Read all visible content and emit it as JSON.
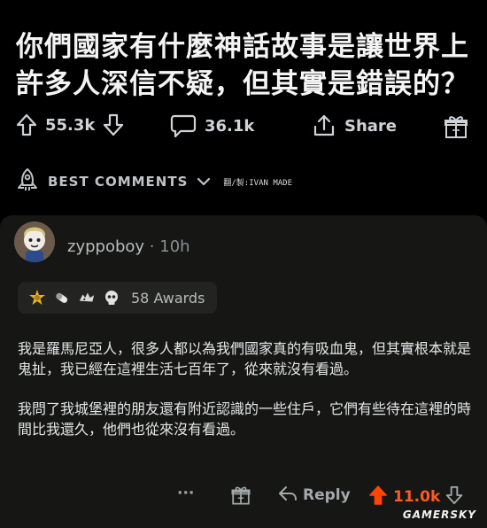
{
  "post": {
    "title": "你們國家有什麼神話故事是讓世界上許多人深信不疑，但其實是錯誤的？",
    "upvotes": "55.3k",
    "comments": "36.1k",
    "share_label": "Share"
  },
  "sort": {
    "label": "BEST COMMENTS",
    "credit": "翻/製:IVAN MADE"
  },
  "comment": {
    "username": "zyppoboy",
    "separator": "·",
    "age": "10h",
    "awards_label": "58 Awards",
    "paragraphs": [
      "我是羅馬尼亞人，很多人都以為我們國家真的有吸血鬼，但其實根本就是鬼扯，我已經在這裡生活七百年了，從來就沒有看過。",
      "我問了我城堡裡的朋友還有附近認識的一些住戶，它們有些待在這裡的時間比我還久，他們也從來沒有看過。"
    ],
    "more_label": "···",
    "reply_label": "Reply",
    "score": "11.0k"
  },
  "watermark": "GAMERSKY",
  "colors": {
    "background": "#000000",
    "card": "#161615",
    "upvote_active": "#ff4500"
  }
}
